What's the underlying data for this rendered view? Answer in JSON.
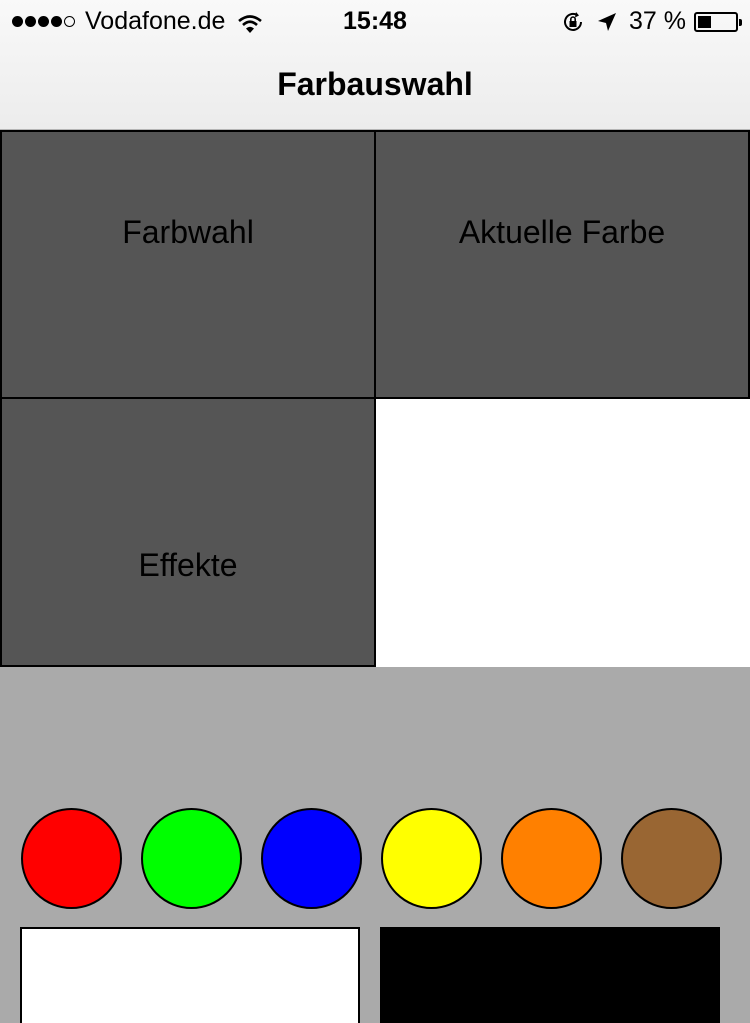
{
  "status_bar": {
    "carrier": "Vodafone.de",
    "time": "15:48",
    "battery": "37 %",
    "battery_level": 0.37,
    "signal_bars": 4,
    "signal_max": 5,
    "icons": [
      "wifi-icon",
      "rotation-lock-icon",
      "location-arrow-icon",
      "battery-icon"
    ]
  },
  "nav": {
    "title": "Farbauswahl"
  },
  "tiles": {
    "farbwahl": "Farbwahl",
    "aktuelle_farbe": "Aktuelle Farbe",
    "effekte": "Effekte"
  },
  "current_color": "#ffffff",
  "palette": {
    "background": "#aaaaaa",
    "swatches": [
      {
        "name": "red",
        "color": "#ff0000"
      },
      {
        "name": "green",
        "color": "#00ff00"
      },
      {
        "name": "blue",
        "color": "#0000ff"
      },
      {
        "name": "yellow",
        "color": "#ffff00"
      },
      {
        "name": "orange",
        "color": "#ff8000"
      },
      {
        "name": "brown",
        "color": "#996633"
      }
    ],
    "rect_swatches": [
      {
        "name": "white",
        "color": "#ffffff"
      },
      {
        "name": "black",
        "color": "#000000"
      }
    ]
  }
}
